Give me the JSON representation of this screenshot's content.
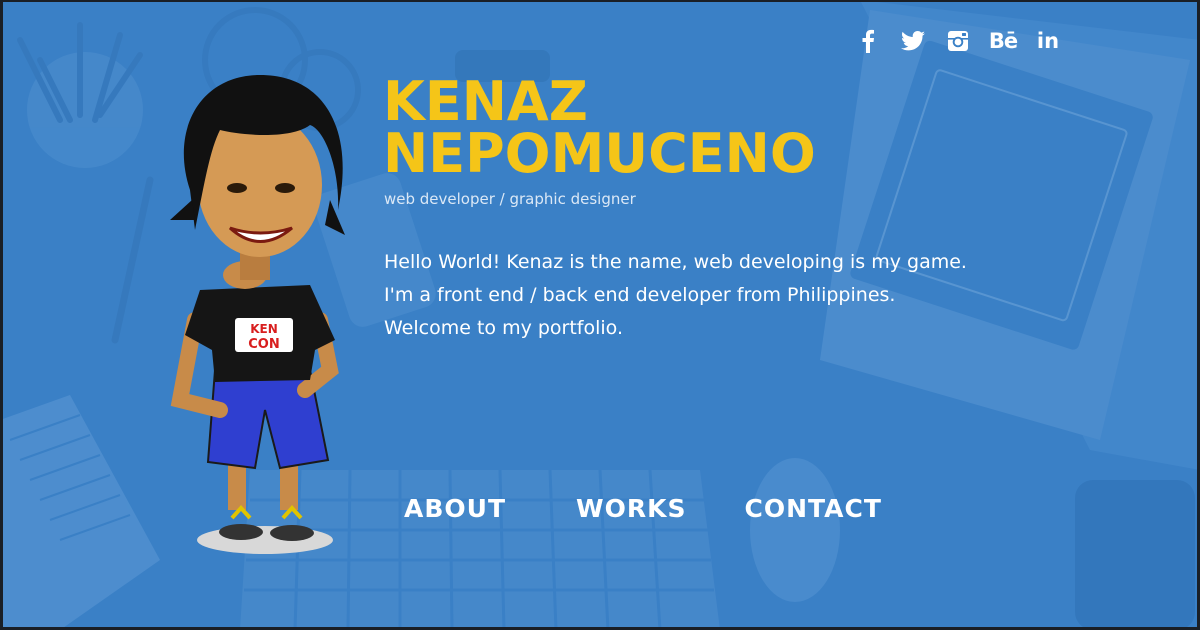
{
  "profile": {
    "first_name": "KENAZ",
    "last_name": "NEPOMUCENO",
    "role": "web developer / graphic designer",
    "intro_lines": [
      "Hello World! Kenaz is the name, web developing is my game.",
      "I'm a front end / back end developer from Philippines.",
      "Welcome to my portfolio."
    ]
  },
  "social": [
    {
      "name": "facebook-icon"
    },
    {
      "name": "twitter-icon"
    },
    {
      "name": "instagram-icon"
    },
    {
      "name": "behance-icon",
      "label": "Bē"
    },
    {
      "name": "linkedin-icon",
      "label": "in"
    }
  ],
  "nav": {
    "about": "ABOUT",
    "works": "WORKS",
    "contact": "CONTACT"
  },
  "shirt_text": [
    "KEN",
    "CON"
  ],
  "colors": {
    "background": "#3a80c6",
    "accent": "#f5c518",
    "text": "#ffffff"
  }
}
